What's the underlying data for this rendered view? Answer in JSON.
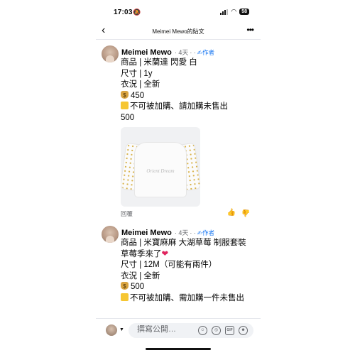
{
  "status_bar": {
    "time": "17:03",
    "battery": "58"
  },
  "nav": {
    "title": "Meimei Mewo的貼文"
  },
  "comments": [
    {
      "author": "Meimei Mewo",
      "meta": "· 4天",
      "dots": "· ·",
      "badge": "✍作者",
      "lines": [
        "商品 | 米蘭達 閃愛 白",
        "尺寸 | 1y",
        "衣況 | 全新",
        "450",
        "不可被加購、請加購未售出",
        "500"
      ],
      "image_caption": "Orient Dream",
      "reply": "回覆"
    },
    {
      "author": "Meimei Mewo",
      "meta": "· 4天",
      "dots": "· ·",
      "badge": "✍作者",
      "lines": [
        "商品 | 米寶麻麻 大湖草莓 制服套裝 草莓季來了",
        "尺寸 | 12M（可能有兩件）",
        "衣況 | 全新",
        "500",
        "不可被加購、需加購一件未售出"
      ]
    }
  ],
  "composer": {
    "placeholder": "撰寫公開…",
    "tools": [
      "☺",
      "◎",
      "GIF",
      "☻"
    ]
  }
}
